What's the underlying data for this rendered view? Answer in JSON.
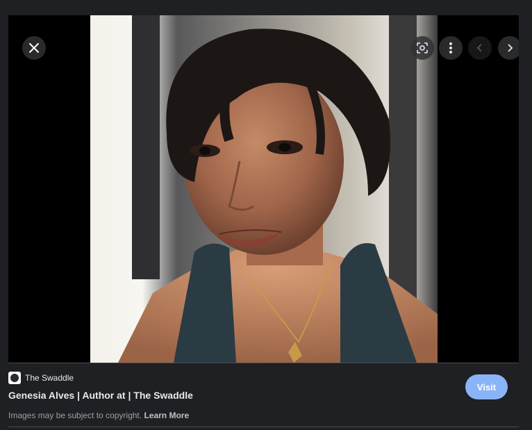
{
  "source": {
    "name": "The Swaddle"
  },
  "result": {
    "title": "Genesia Alves | Author at | The Swaddle"
  },
  "actions": {
    "visit_label": "Visit"
  },
  "copyright": {
    "notice": "Images may be subject to copyright.",
    "learn_more_label": "Learn More"
  },
  "icons": {
    "close": "close-icon",
    "lens": "lens-icon",
    "more": "more-vertical-icon",
    "prev": "chevron-left-icon",
    "next": "chevron-right-icon"
  },
  "colors": {
    "background": "#1f2023",
    "accent": "#8ab4f8",
    "text_primary": "#e8eaed",
    "text_secondary": "#9aa0a6"
  }
}
